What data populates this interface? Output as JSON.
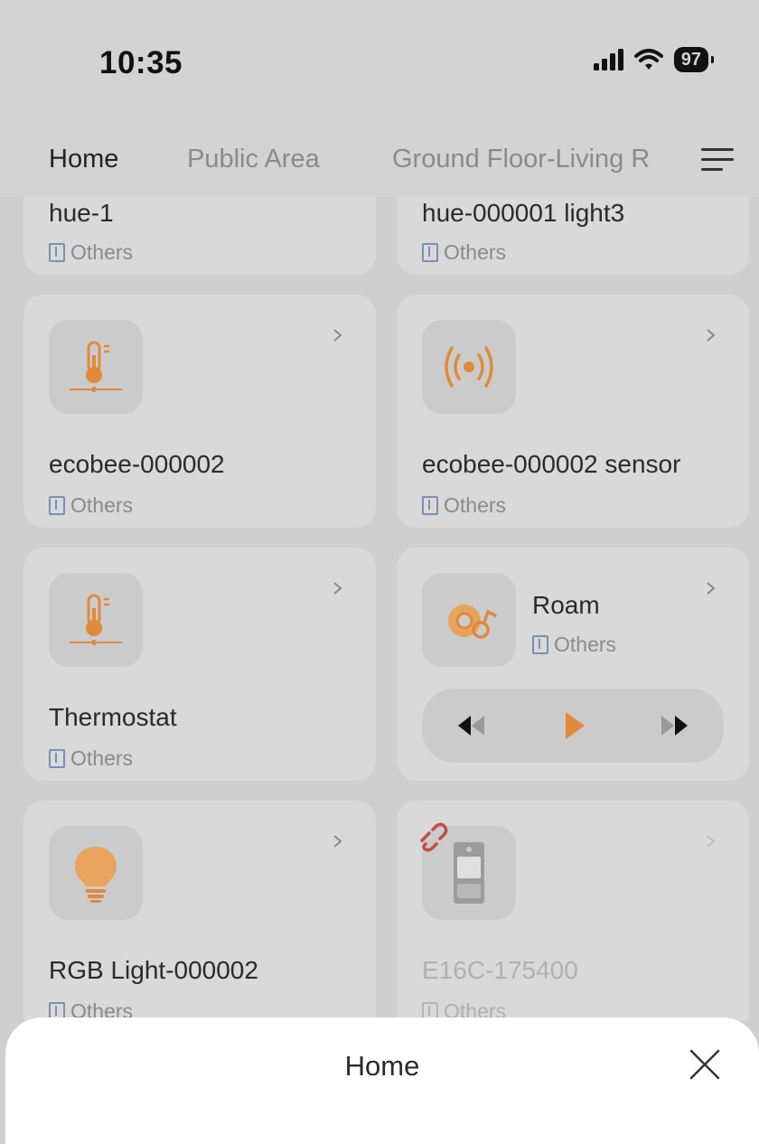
{
  "status": {
    "time": "10:35",
    "battery": "97"
  },
  "tabs": [
    {
      "label": "Home"
    },
    {
      "label": "Public Area"
    },
    {
      "label": "Ground Floor-Living R"
    }
  ],
  "cards": [
    {
      "name": "hue-1",
      "room": "Others",
      "icon": "light-icon"
    },
    {
      "name": "hue-000001 light3",
      "room": "Others",
      "icon": "light-icon"
    },
    {
      "name": "ecobee-000002",
      "room": "Others",
      "icon": "thermometer-icon"
    },
    {
      "name": "ecobee-000002 sensor",
      "room": "Others",
      "icon": "sensor-waves-icon"
    },
    {
      "name": "Thermostat",
      "room": "Others",
      "icon": "thermometer-icon"
    },
    {
      "name": "Roam",
      "room": "Others",
      "icon": "speaker-icon"
    },
    {
      "name": "RGB Light-000002",
      "room": "Others",
      "icon": "bulb-icon"
    },
    {
      "name": "E16C-175400",
      "room": "Others",
      "icon": "intercom-icon",
      "status": "offline"
    }
  ],
  "sheet": {
    "title": "Home"
  },
  "colors": {
    "accent": "#e08a3c",
    "offline": "#c94b4b",
    "room_icon": "#7b8fb5"
  }
}
